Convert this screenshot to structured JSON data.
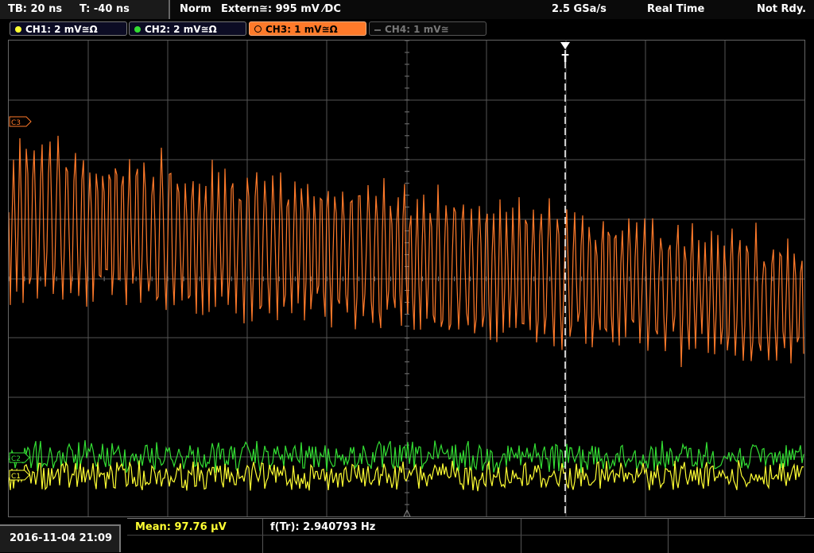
{
  "status": {
    "timebase": "TB: 20 ns",
    "trigger_time": "T: -40 ns",
    "mode": "Norm",
    "trigger_source": "Extern≅: 995 mV ⁄DC",
    "sample_rate": "2.5 GSa/s",
    "acq_mode": "Real Time",
    "state": "Not Rdy."
  },
  "channels": [
    {
      "label": "CH1: 2 mV≅Ω",
      "color": "#ffff33"
    },
    {
      "label": "CH2: 2 mV≅Ω",
      "color": "#33dd33"
    },
    {
      "label": "CH3: 1 mV≅Ω",
      "color": "#ff7a2a"
    },
    {
      "label": "CH4: 1 mV≅",
      "color": "#555555"
    }
  ],
  "markers": {
    "ch3": "C3",
    "ch2": "C2",
    "ch1": "C1",
    "trigger": "T"
  },
  "measurements": {
    "date": "2016-11-04 21:09",
    "mean": "Mean: 97.76 µV",
    "freq": "f(Tr): 2.940793 Hz"
  },
  "colors": {
    "ch1": "#ffff33",
    "ch2": "#33dd33",
    "ch3": "#ff7a2a",
    "grid": "#555555"
  }
}
